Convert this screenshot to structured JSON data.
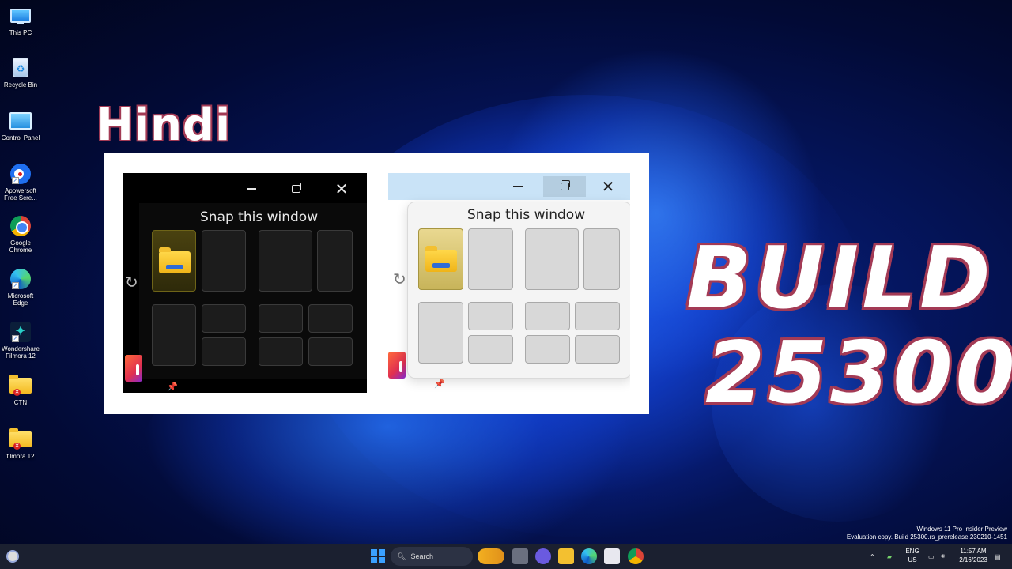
{
  "desktop_icons": [
    {
      "label": "This PC",
      "icon": "this-pc-icon"
    },
    {
      "label": "Recycle Bin",
      "icon": "recycle-bin-icon"
    },
    {
      "label": "Control Panel",
      "icon": "control-panel-icon"
    },
    {
      "label": "Apowersoft Free Scre...",
      "icon": "apowersoft-icon"
    },
    {
      "label": "Google Chrome",
      "icon": "chrome-icon"
    },
    {
      "label": "Microsoft Edge",
      "icon": "edge-icon"
    },
    {
      "label": "Wondershare Filmora 12",
      "icon": "filmora-icon"
    },
    {
      "label": "CTN",
      "icon": "folder-icon"
    },
    {
      "label": "filmora 12",
      "icon": "folder-icon"
    }
  ],
  "overlay": {
    "hindi": "Hindi",
    "build_line1": "BUILD",
    "build_line2": "25300",
    "accent_color": "#a33a55"
  },
  "comparison": {
    "dark": {
      "snap_title": "Snap this window"
    },
    "light": {
      "snap_title": "Snap this window"
    }
  },
  "watermark": {
    "line1": "Windows 11 Pro Insider Preview",
    "line2": "Evaluation copy. Build 25300.rs_prerelease.230210-1451"
  },
  "taskbar": {
    "search_label": "Search",
    "lang_line1": "ENG",
    "lang_line2": "US",
    "time": "11:57 AM",
    "date": "2/16/2023"
  }
}
